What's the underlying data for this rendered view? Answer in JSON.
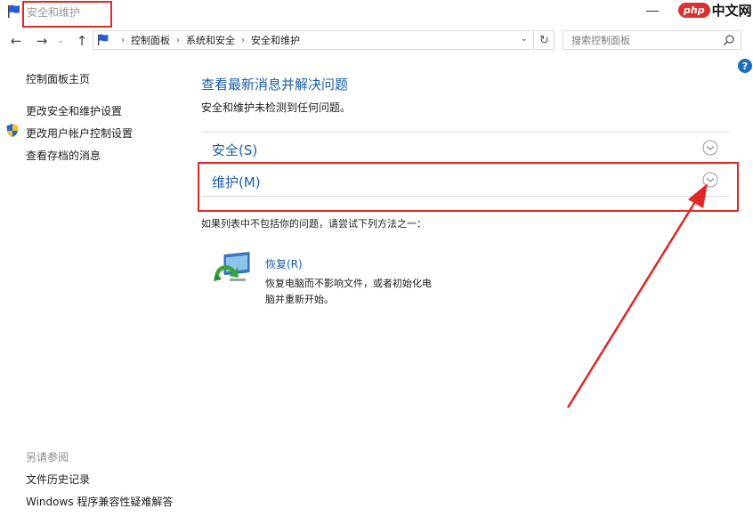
{
  "window": {
    "title": "安全和维护",
    "logo": {
      "badge": "php",
      "text": "中文网"
    }
  },
  "nav": {
    "back": "←",
    "forward": "→",
    "history": "⌄",
    "up": "↑",
    "breadcrumbs": [
      "控制面板",
      "系统和安全",
      "安全和维护"
    ],
    "refresh": "↻",
    "search_placeholder": "搜索控制面板",
    "help": "?"
  },
  "sidebar": {
    "home": "控制面板主页",
    "links": [
      "更改安全和维护设置",
      "更改用户帐户控制设置",
      "查看存档的消息"
    ],
    "see_also_heading": "另请参阅",
    "see_also": [
      "文件历史记录",
      "Windows 程序兼容性疑难解答"
    ]
  },
  "main": {
    "title": "查看最新消息并解决问题",
    "subtitle": "安全和维护未检测到任何问题。",
    "sections": [
      {
        "label": "安全(S)"
      },
      {
        "label": "维护(M)"
      }
    ],
    "hint": "如果列表中不包括你的问题，请尝试下列方法之一：",
    "recovery": {
      "link": "恢复(R)",
      "description": "恢复电脑而不影响文件，或者初始化电脑并重新开始。"
    }
  },
  "colors": {
    "highlight": "#e02727",
    "link": "#1a5fa8",
    "help": "#1d6fc0",
    "logo_badge": "#d8332f"
  }
}
